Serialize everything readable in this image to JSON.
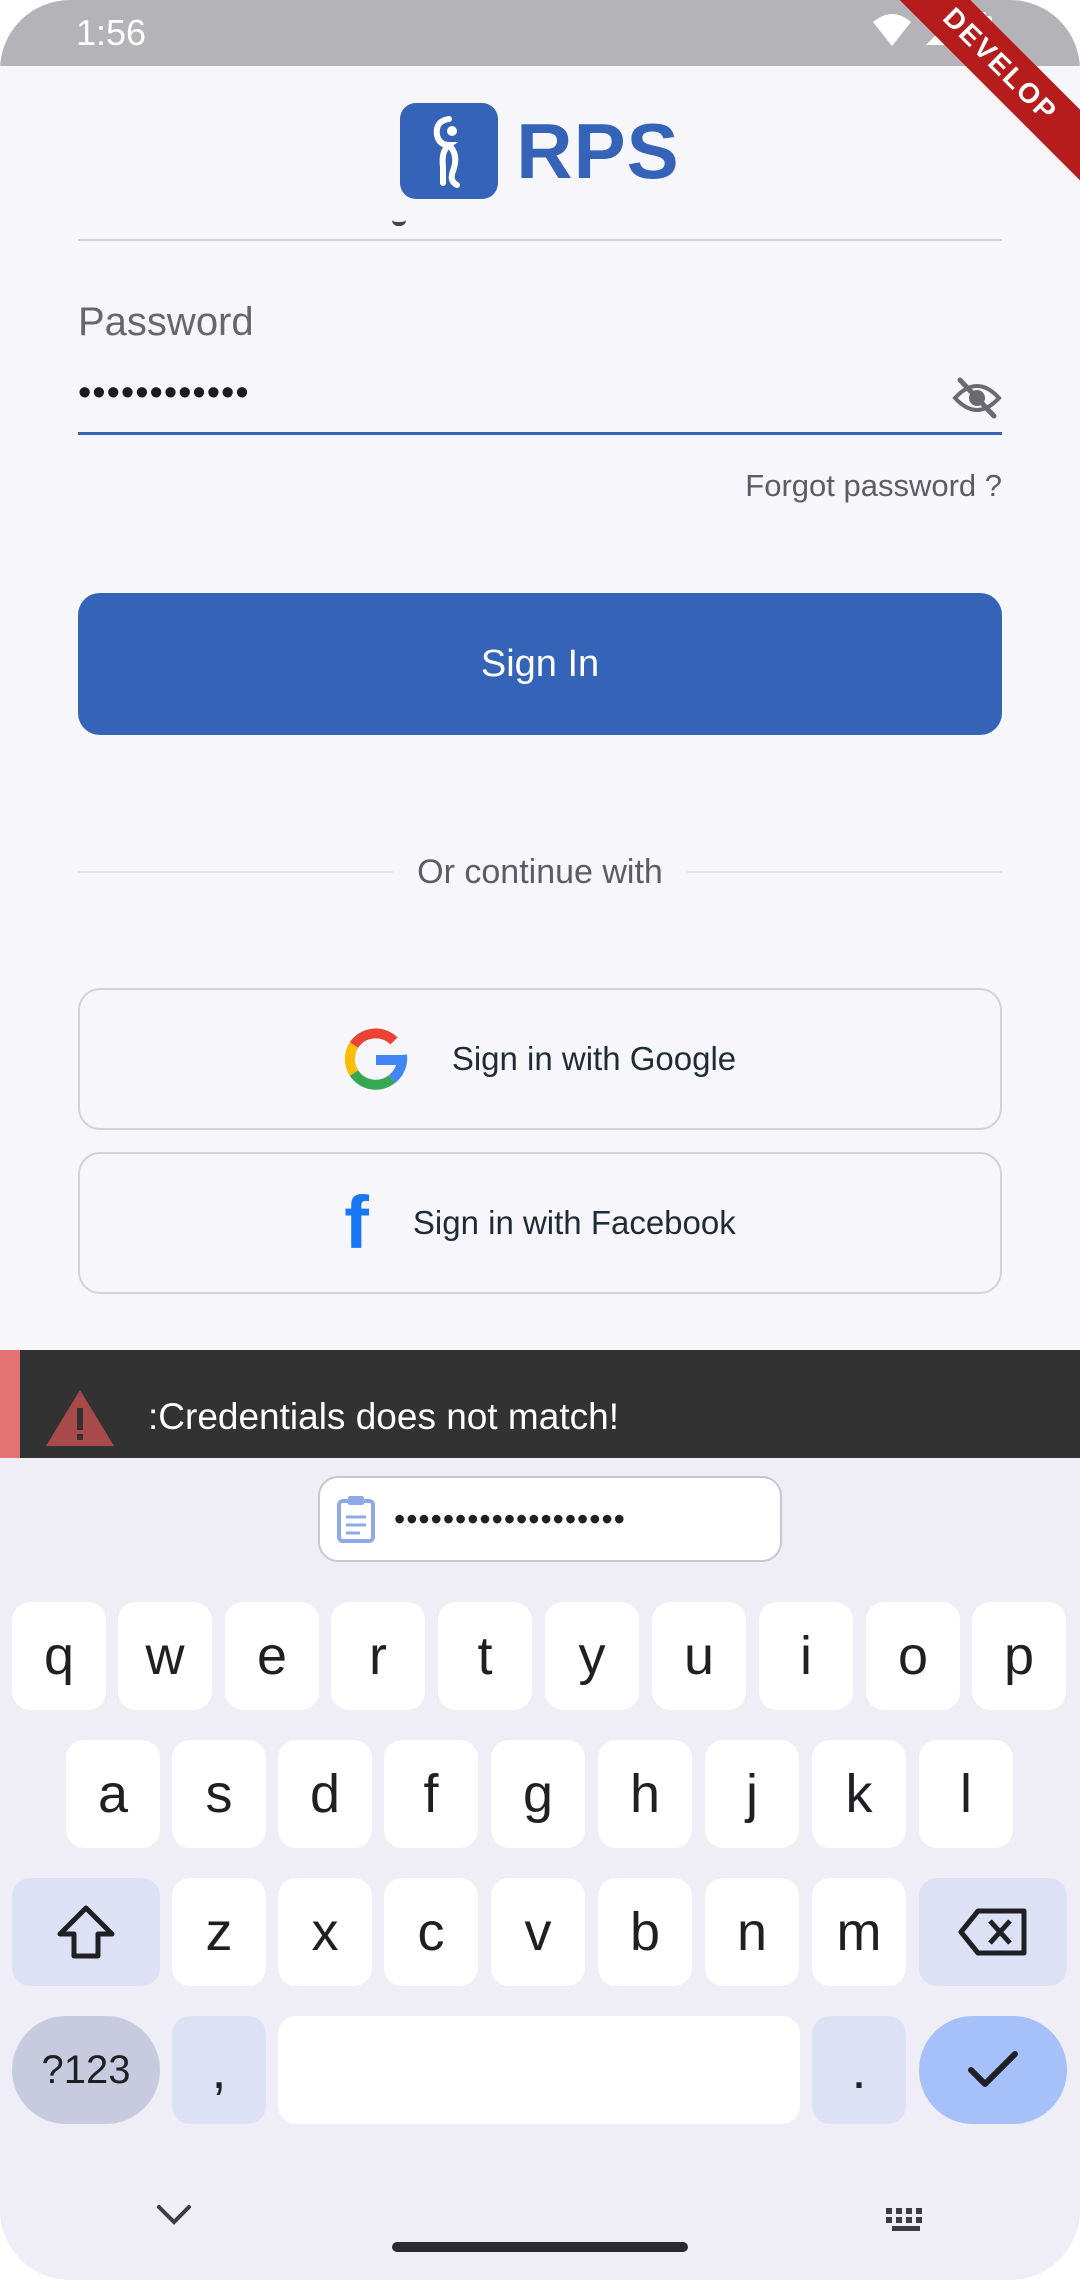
{
  "status_bar": {
    "time": "1:56",
    "ribbon": "DEVELOP"
  },
  "app": {
    "logo_text": "RPS",
    "brand_color": "#3563b8"
  },
  "form": {
    "password_label": "Password",
    "password_value": "••••••••••••",
    "forgot_password": "Forgot password ?",
    "sign_in": "Sign In"
  },
  "divider": {
    "text": "Or continue with"
  },
  "social": {
    "google": "Sign in with Google",
    "facebook": "Sign in with Facebook"
  },
  "snackbar": {
    "message": ":Credentials does not match!",
    "accent_color": "#e57373"
  },
  "keyboard": {
    "clipboard_text": "•••••••••••••••••••",
    "row1": [
      "q",
      "w",
      "e",
      "r",
      "t",
      "y",
      "u",
      "i",
      "o",
      "p"
    ],
    "row2": [
      "a",
      "s",
      "d",
      "f",
      "g",
      "h",
      "j",
      "k",
      "l"
    ],
    "row3": [
      "z",
      "x",
      "c",
      "v",
      "b",
      "n",
      "m"
    ],
    "symbols_key": "?123",
    "comma_key": ",",
    "period_key": "."
  }
}
